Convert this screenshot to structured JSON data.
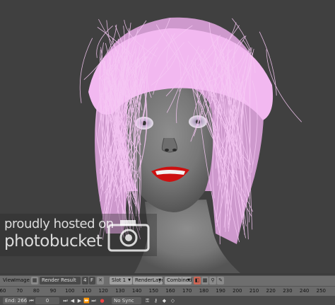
{
  "watermark": {
    "line1": "proudly hosted on",
    "line2": "photobucket"
  },
  "header": {
    "menu_view": "View",
    "menu_image": "Image",
    "image_name": "Render Result",
    "users_count": "4",
    "fake_user": "F",
    "slot": "Slot 1",
    "render_layer": "RenderLayer",
    "render_pass": "Combined"
  },
  "ruler": {
    "ticks": [
      "60",
      "70",
      "80",
      "90",
      "100",
      "110",
      "120",
      "130",
      "140",
      "150",
      "160",
      "170",
      "180",
      "190",
      "200",
      "210",
      "220",
      "230",
      "240",
      "250"
    ]
  },
  "footer": {
    "end_frame": "End: 266",
    "current_frame": "0",
    "sync_mode": "No Sync"
  },
  "colors": {
    "hair": "#f2b8f0",
    "skin": "#7e7e7e",
    "lips": "#cc1010",
    "background": "#404040",
    "header_bar": "#6e6e6e"
  },
  "icons": {
    "editor_type": "image-editor-icon",
    "camera": "camera-icon"
  }
}
